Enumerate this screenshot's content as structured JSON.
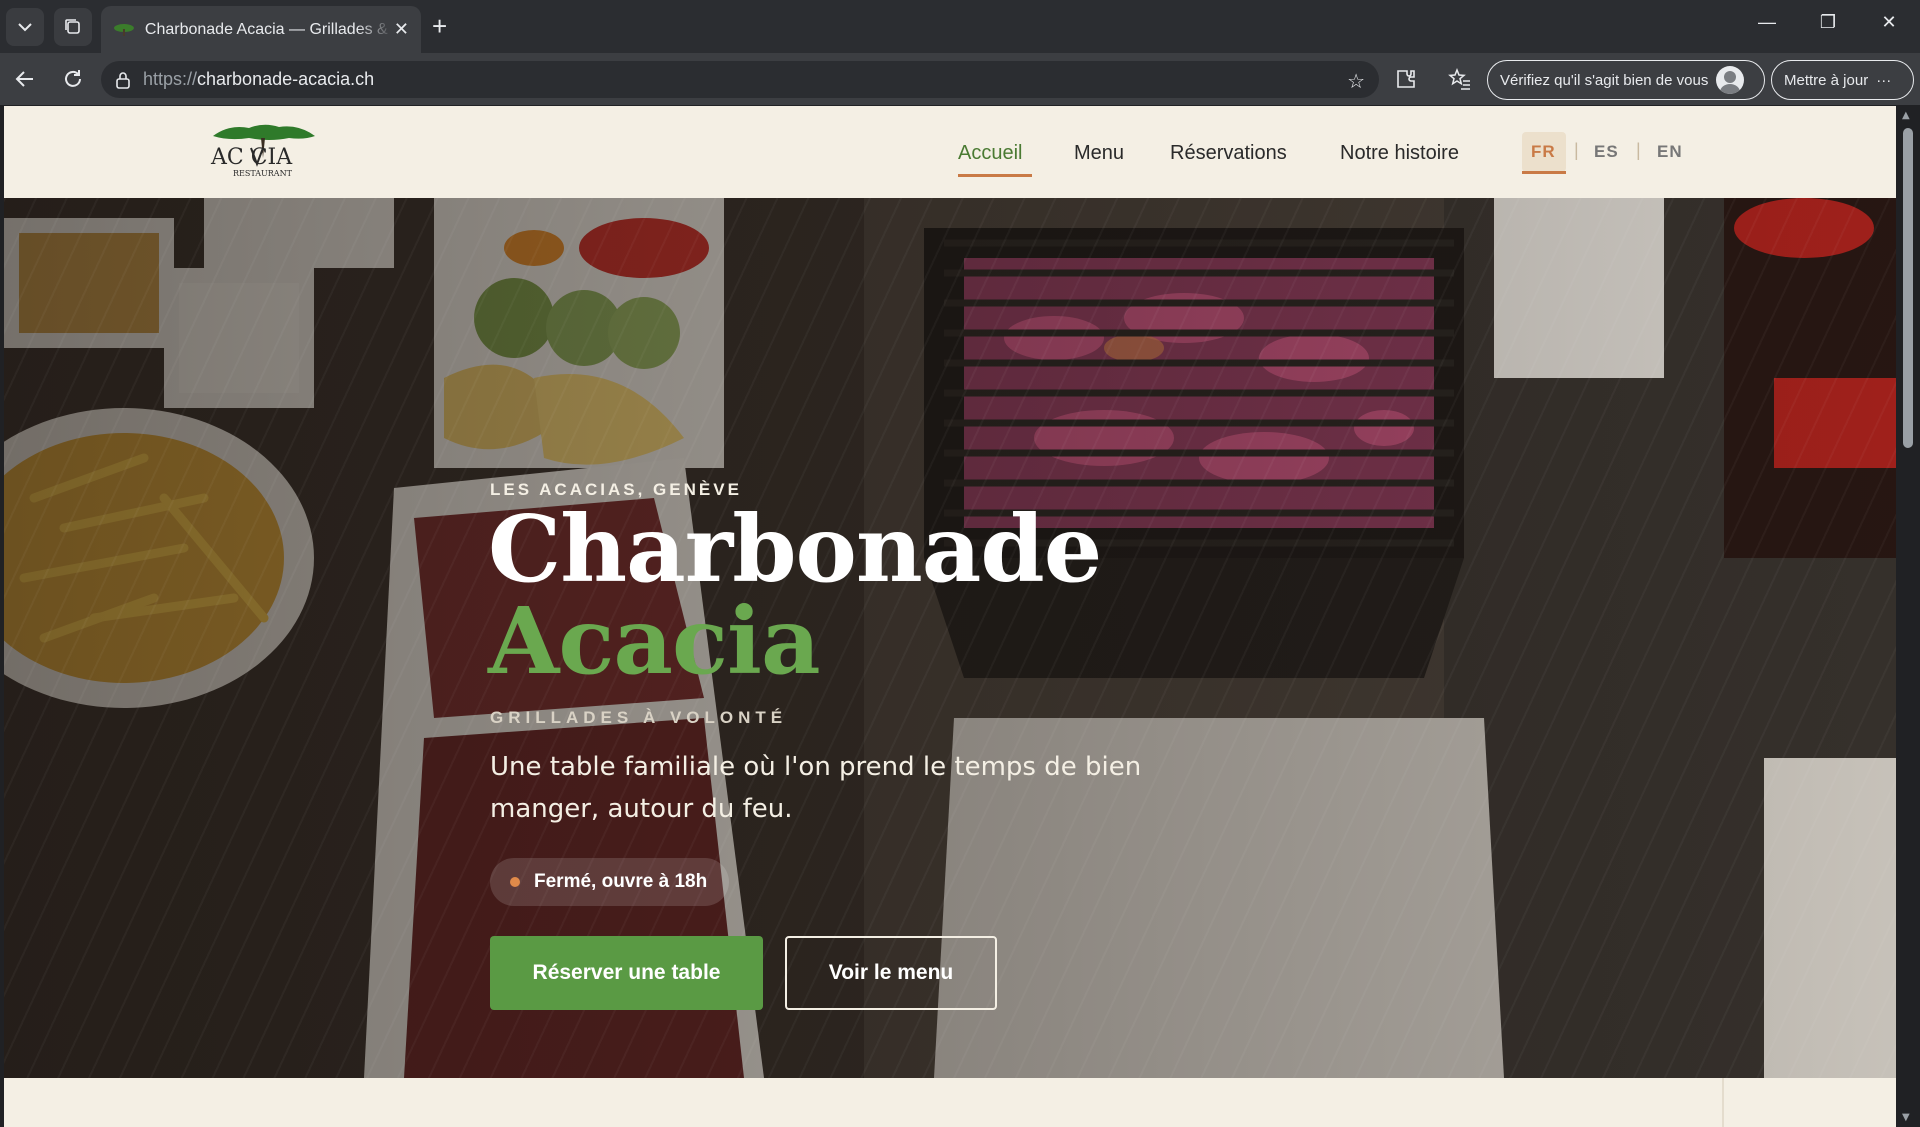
{
  "browser": {
    "tab_title": "Charbonade Acacia — Grillades & Rôtisserie",
    "url_protocol": "https://",
    "url_host": "charbonade-acacia.ch",
    "profile_prompt": "Vérifiez qu'il s'agit bien de vous",
    "update_label": "Mettre à jour",
    "more_label": "···"
  },
  "site": {
    "logo_text": "AC  CIA",
    "logo_sub": "RESTAURANT",
    "nav": [
      {
        "label": "Accueil"
      },
      {
        "label": "Menu"
      },
      {
        "label": "Réservations"
      },
      {
        "label": "Notre histoire"
      }
    ],
    "languages": [
      "FR",
      "ES",
      "EN"
    ],
    "lang_separator": "|",
    "active_language": "FR"
  },
  "hero": {
    "kicker": "LES ACACIAS, GENÈVE",
    "title_line1": "Charbonade",
    "title_line2": "Acacia",
    "tagline": "GRILLADES À VOLONTÉ",
    "description": "Une table familiale où l'on prend le temps de bien manger, autour du feu.",
    "status": "Fermé, ouvre à 18h",
    "cta_primary": "Réserver une table",
    "cta_secondary": "Voir le menu"
  },
  "colors": {
    "accent_green": "#5a9a44",
    "title_green": "#6aa84f",
    "accent_orange": "#c97a46",
    "page_bg": "#f4efe4"
  }
}
